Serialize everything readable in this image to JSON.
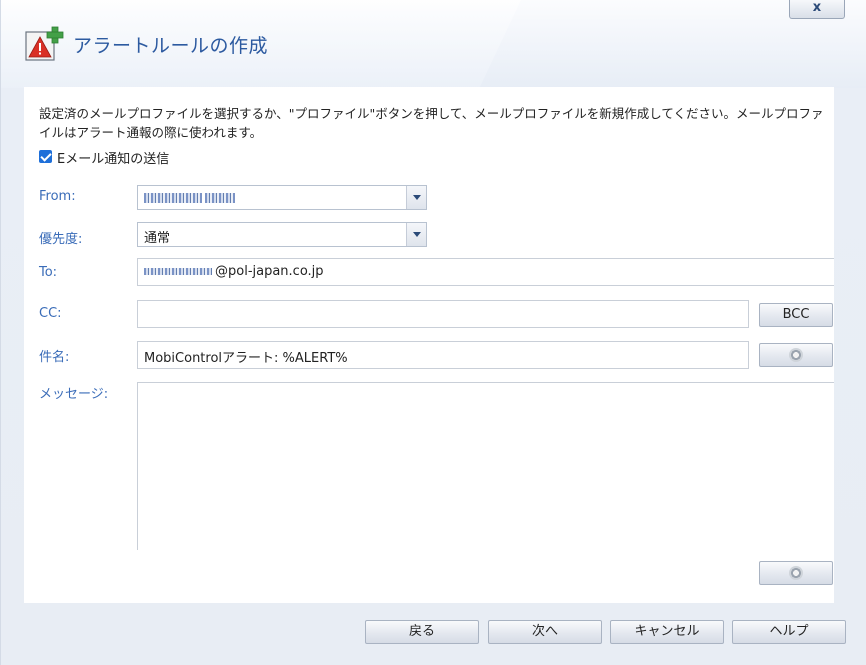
{
  "window": {
    "title": "アラートルールの作成",
    "close_label": "x"
  },
  "description": "設定済のメールプロファイルを選択するか、\"プロファイル\"ボタンを押して、メールプロファイルを新規作成してください。メールプロファイルはアラート通報の際に使われます。",
  "send_email": {
    "checked": true,
    "label": "Eメール通知の送信"
  },
  "form": {
    "from": {
      "label": "From:",
      "value": ""
    },
    "priority": {
      "label": "優先度:",
      "value": "通常"
    },
    "to": {
      "label": "To:",
      "value_suffix": "@pol-japan.co.jp"
    },
    "cc": {
      "label": "CC:",
      "value": "",
      "bcc_button": "BCC"
    },
    "subject": {
      "label": "件名:",
      "value": "MobiControlアラート: %ALERT%"
    },
    "message": {
      "label": "メッセージ:",
      "value": ""
    }
  },
  "footer": {
    "back": "戻る",
    "next": "次へ",
    "cancel": "キャンセル",
    "help": "ヘルプ"
  },
  "icons": {
    "title": "alert-rule-add-icon",
    "subject_macro": "gear-icon",
    "message_macro": "gear-icon"
  },
  "colors": {
    "label": "#3a6cb8",
    "title": "#2c5aa0",
    "checkbox": "#1e6fd9"
  }
}
